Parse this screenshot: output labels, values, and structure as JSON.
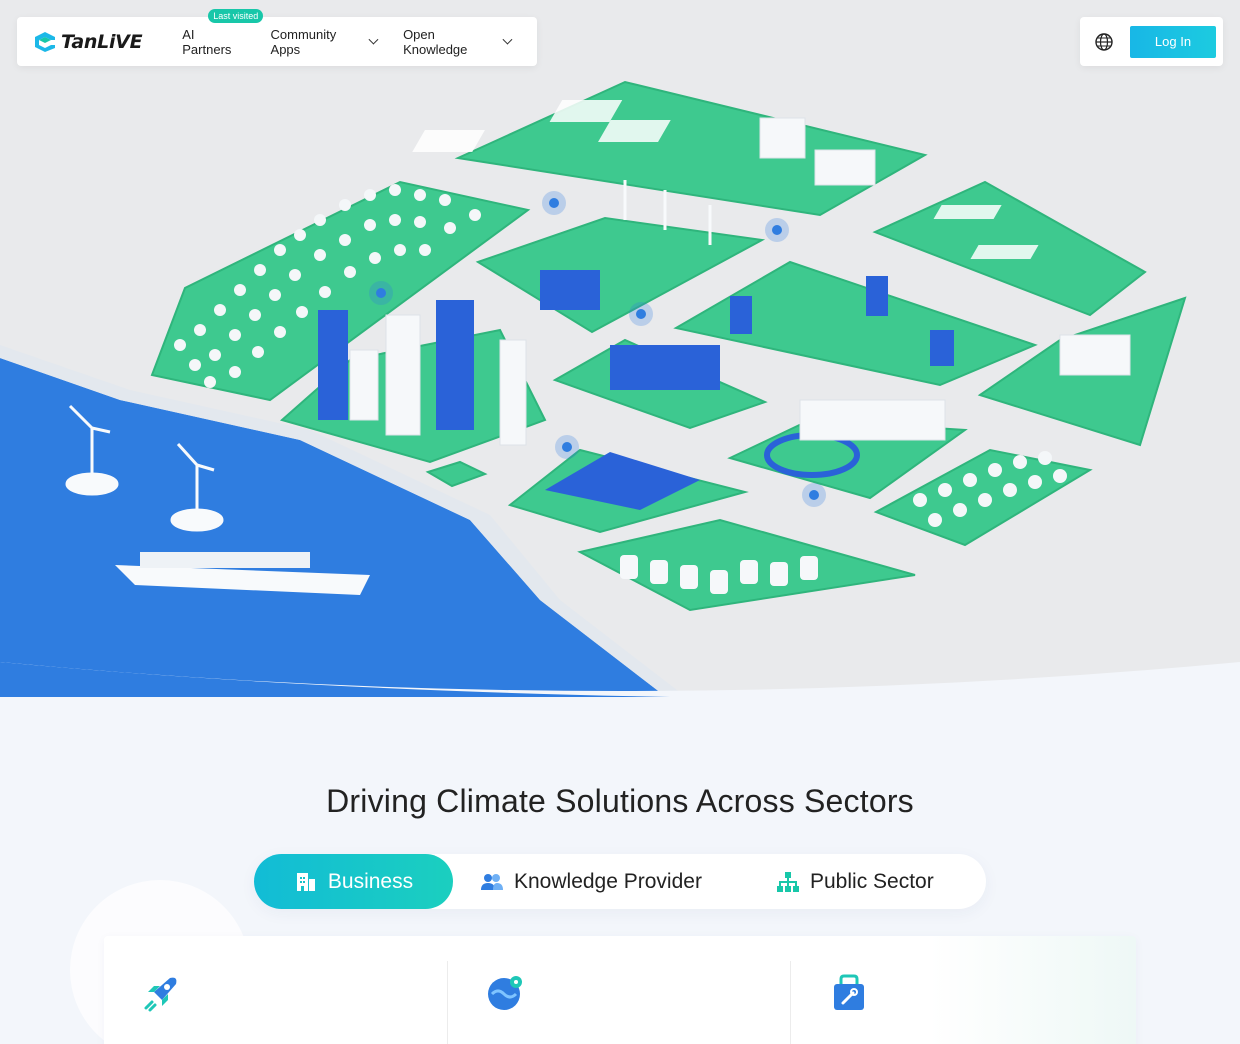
{
  "nav": {
    "logo_text": "TanLiVE",
    "items": [
      {
        "label": "AI Partners",
        "badge": "Last visited"
      },
      {
        "label": "Community Apps"
      },
      {
        "label": "Open Knowledge"
      }
    ],
    "login_label": "Log In",
    "language_icon": "globe-icon"
  },
  "section": {
    "title": "Driving Climate Solutions Across Sectors",
    "tabs": [
      {
        "label": "Business",
        "icon": "building-icon",
        "active": true
      },
      {
        "label": "Knowledge Provider",
        "icon": "people-icon",
        "active": false
      },
      {
        "label": "Public Sector",
        "icon": "org-chart-icon",
        "active": false
      }
    ],
    "cards": [
      {
        "icon": "rocket-icon"
      },
      {
        "icon": "globe-pin-icon"
      },
      {
        "icon": "toolbox-icon"
      }
    ]
  },
  "colors": {
    "accent": "#18c7a9",
    "brand_blue": "#2f7de0",
    "green_plot": "#3ec98f",
    "login_gradient_start": "#18b7e6"
  }
}
